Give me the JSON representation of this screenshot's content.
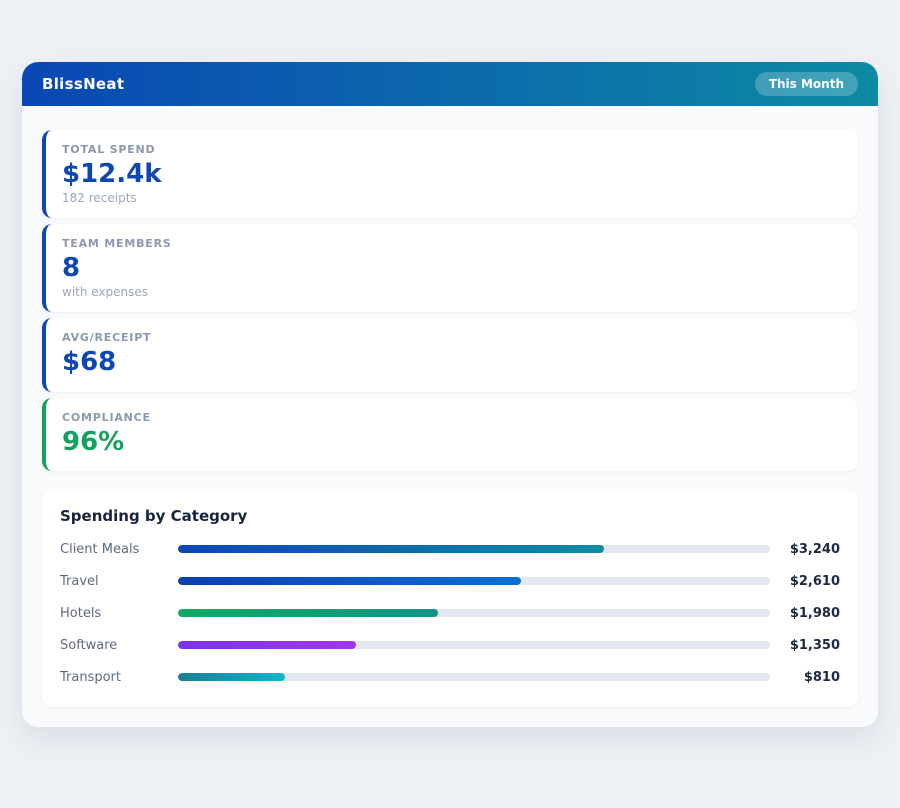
{
  "header": {
    "app_name": "BlissNeat",
    "period_badge": "This Month"
  },
  "stats": [
    {
      "label": "TOTAL SPEND",
      "value": "$12.4k",
      "sub": "182 receipts",
      "accent": "#0d47b4"
    },
    {
      "label": "TEAM MEMBERS",
      "value": "8",
      "sub": "with expenses",
      "accent": "#0d47b4"
    },
    {
      "label": "AVG/RECEIPT",
      "value": "$68",
      "sub": "",
      "accent": "#0d47b4"
    },
    {
      "label": "COMPLIANCE",
      "value": "96%",
      "sub": "",
      "accent": "#12a15e"
    }
  ],
  "chart_data": {
    "type": "bar",
    "orientation": "horizontal",
    "title": "Spending by Category",
    "categories": [
      "Client Meals",
      "Travel",
      "Hotels",
      "Software",
      "Transport"
    ],
    "values": [
      3240,
      2610,
      1980,
      1350,
      810
    ],
    "value_labels": [
      "$3,240",
      "$2,610",
      "$1,980",
      "$1,350",
      "$810"
    ],
    "xlim": [
      0,
      4500
    ],
    "grid": false,
    "track_color": "#e2e8f0",
    "bar_gradients": [
      [
        "#0b46b4",
        "#0d8ca4"
      ],
      [
        "#0a3fae",
        "#0b6fd0"
      ],
      [
        "#0baa62",
        "#0f9488"
      ],
      [
        "#7c35e8",
        "#a335f2"
      ],
      [
        "#177e96",
        "#12b5cd"
      ]
    ]
  }
}
